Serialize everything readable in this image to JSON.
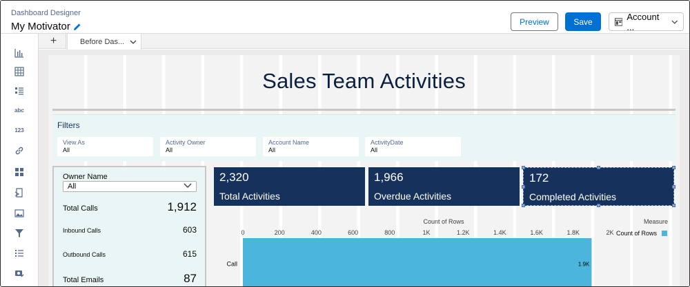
{
  "header": {
    "app_title": "Dashboard Designer",
    "dashboard_name": "My Motivator",
    "preview_label": "Preview",
    "save_label": "Save",
    "account_label": "Account ..."
  },
  "tabs": {
    "add_label": "+",
    "items": [
      {
        "label": "Before Das..."
      }
    ]
  },
  "toolbar": {
    "items": [
      {
        "icon": "bar-chart-icon"
      },
      {
        "icon": "table-icon"
      },
      {
        "icon": "list-icon"
      },
      {
        "icon": "text-icon",
        "label": "abc"
      },
      {
        "icon": "number-icon",
        "label": "123"
      },
      {
        "icon": "link-icon"
      },
      {
        "icon": "container-icon"
      },
      {
        "icon": "embed-icon"
      },
      {
        "icon": "image-icon"
      },
      {
        "icon": "filter-icon"
      },
      {
        "icon": "list-selector-icon"
      },
      {
        "icon": "sync-icon"
      }
    ]
  },
  "title_widget": {
    "text": "Sales Team Activities"
  },
  "filters": {
    "label": "Filters",
    "items": [
      {
        "label": "View As",
        "value": "All"
      },
      {
        "label": "Activity Owner",
        "value": "All"
      },
      {
        "label": "Account Name",
        "value": "All"
      },
      {
        "label": "ActivityDate",
        "value": "All"
      }
    ]
  },
  "owner_panel": {
    "label": "Owner Name",
    "selected": "All",
    "metrics": [
      {
        "label": "Total Calls",
        "value": "1,912"
      },
      {
        "label": "Inbound Calls",
        "value": "603"
      },
      {
        "label": "Outbound Calls",
        "value": "615"
      },
      {
        "label": "Total Emails",
        "value": "87"
      }
    ]
  },
  "kpis": [
    {
      "value": "2,320",
      "label": "Total Activities"
    },
    {
      "value": "1,966",
      "label": "Overdue Activities"
    },
    {
      "value": "172",
      "label": "Completed Activities"
    }
  ],
  "colors": {
    "primary": "#0070d2",
    "kpi_bg": "#16325c",
    "bar": "#4bb5dc",
    "filter_bg": "#eaf5f6"
  },
  "chart_data": {
    "type": "bar",
    "orientation": "horizontal",
    "title": "",
    "xlabel": "Count of Rows",
    "ylabel": "",
    "categories": [
      "Call"
    ],
    "values": [
      1900
    ],
    "value_labels": [
      "1.9K"
    ],
    "x_ticks": [
      "0",
      "200",
      "400",
      "600",
      "800",
      "1K",
      "1.2K",
      "1.4K",
      "1.6K",
      "1.8K",
      "2K"
    ],
    "xlim": [
      0,
      2000
    ],
    "legend": {
      "title": "Measure",
      "entries": [
        {
          "name": "Count of Rows",
          "color": "#4bb5dc"
        }
      ],
      "placement": "right"
    },
    "grid": true
  }
}
